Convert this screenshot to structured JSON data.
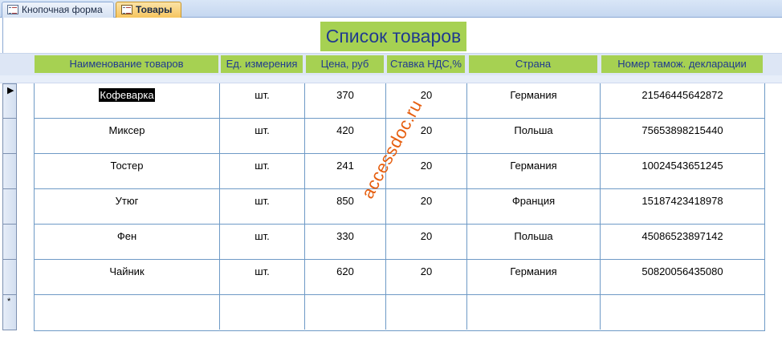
{
  "tabs": [
    {
      "label": "Кнопочная форма",
      "active": false
    },
    {
      "label": "Товары",
      "active": true
    }
  ],
  "form": {
    "title": "Список товаров",
    "columns": [
      "Наименование товаров",
      "Ед. измерения",
      "Цена, руб",
      "Ставка НДС,%",
      "Страна",
      "Номер тамож. декларации"
    ],
    "rows": [
      [
        "Кофеварка",
        "шт.",
        "370",
        "20",
        "Германия",
        "21546445642872"
      ],
      [
        "Миксер",
        "шт.",
        "420",
        "20",
        "Польша",
        "75653898215440"
      ],
      [
        "Тостер",
        "шт.",
        "241",
        "20",
        "Германия",
        "10024543651245"
      ],
      [
        "Утюг",
        "шт.",
        "850",
        "20",
        "Франция",
        "15187423418978"
      ],
      [
        "Фен",
        "шт.",
        "330",
        "20",
        "Польша",
        "45086523897142"
      ],
      [
        "Чайник",
        "шт.",
        "620",
        "20",
        "Германия",
        "50820056435080"
      ],
      [
        "",
        "",
        "",
        "",
        "",
        ""
      ]
    ],
    "current_record_marker": "▶",
    "new_record_marker": "*"
  },
  "watermark": "accessdoc.ru",
  "colors": {
    "header_fill": "#a6d152",
    "header_text": "#203a8f",
    "grid_line": "#6e9ac6",
    "active_tab": "#f6c55f",
    "watermark": "#e65f10"
  }
}
